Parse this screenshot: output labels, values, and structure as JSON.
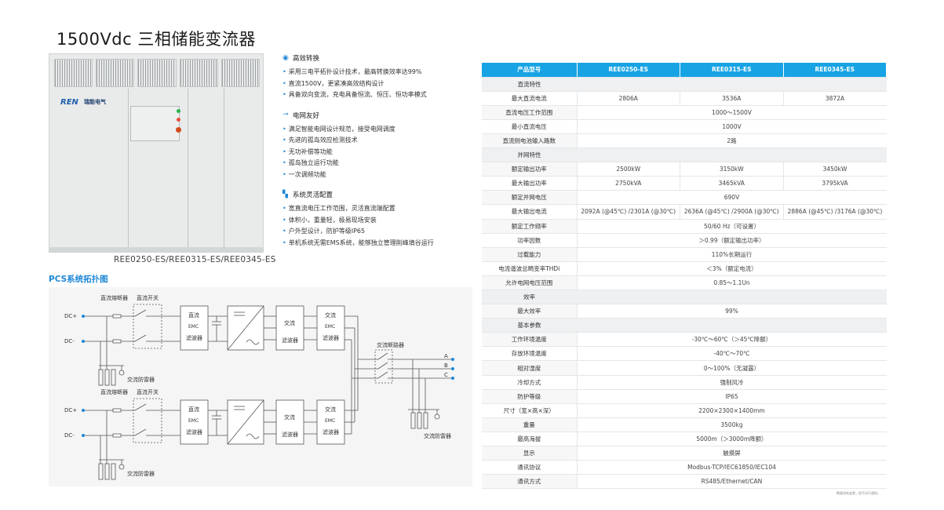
{
  "title": "1500Vdc 三相储能变流器",
  "cabinet": {
    "brand": "REN",
    "brand_cn": "瑞能电气",
    "brand_en": "Reneera Electric"
  },
  "model_caption": "REE0250-ES/REE0315-ES/REE0345-ES",
  "features": [
    {
      "heading": "高效转换",
      "icon": "efficiency-icon",
      "items": [
        "采用三电平拓扑设计技术，最高转换效率达99%",
        "直流1500V，更紧凑高效结构设计",
        "具备双向变流，充电具备恒流、恒压、恒功率模式"
      ]
    },
    {
      "heading": "电网友好",
      "icon": "grid-icon",
      "items": [
        "满足智能电网设计规范，接受电网调度",
        "先进的孤岛效应检测技术",
        "无功补偿等功能",
        "孤岛独立运行功能",
        "一次调频功能"
      ]
    },
    {
      "heading": "系统灵活配置",
      "icon": "config-icon",
      "items": [
        "宽直流电压工作范围，灵活直流端配置",
        "体积小，重量轻，极易现场安装",
        "户外型设计，防护等级IP65",
        "单机系统无需EMS系统，能够独立管理削峰填谷运行"
      ]
    }
  ],
  "topology": {
    "title": "PCS系统拓扑图",
    "dc_fuse": "直流熔断器",
    "dc_switch": "直流开关",
    "dc_plus": "DC+",
    "dc_minus": "DC-",
    "dc_emc": [
      "直流",
      "EMC",
      "滤波器"
    ],
    "ac_filter": [
      "交流",
      "滤波器"
    ],
    "ac_emc": [
      "交流",
      "EMC",
      "滤波器"
    ],
    "ac_breaker": "交流断路器",
    "surge": "交流防雷器",
    "phases": [
      "A",
      "B",
      "C"
    ]
  },
  "spec": {
    "header": [
      "产品型号",
      "REE0250-ES",
      "REE0315-ES",
      "REE0345-ES"
    ],
    "rows": [
      {
        "type": "section",
        "label": "直流特性"
      },
      {
        "label": "最大直流电流",
        "values": [
          "2806A",
          "3536A",
          "3872A"
        ]
      },
      {
        "label": "直流电压工作范围",
        "span": "1000～1500V"
      },
      {
        "label": "最小直流电压",
        "span": "1000V"
      },
      {
        "label": "直流侧电池输入路数",
        "span": "2路"
      },
      {
        "type": "section",
        "label": "并网特性"
      },
      {
        "label": "额定输出功率",
        "values": [
          "2500kW",
          "3150kW",
          "3450kW"
        ]
      },
      {
        "label": "最大输出功率",
        "values": [
          "2750kVA",
          "3465kVA",
          "3795kVA"
        ]
      },
      {
        "label": "额定并网电压",
        "span": "690V"
      },
      {
        "label": "最大输出电流",
        "values": [
          "2092A (@45℃) /2301A (@30℃)",
          "2636A (@45℃) /2900A (@30℃)",
          "2886A (@45℃) /3176A (@30℃)"
        ]
      },
      {
        "label": "额定工作频率",
        "span": "50/60 Hz（可设置）"
      },
      {
        "label": "功率因数",
        "span": "＞0.99（额定输出功率）"
      },
      {
        "label": "过载能力",
        "span": "110%长期运行"
      },
      {
        "label": "电流谐波总畸变率THDi",
        "span": "＜3%（额定电流）"
      },
      {
        "label": "允许电网电压范围",
        "span": "0.85～1.1Un"
      },
      {
        "type": "section",
        "label": "效率"
      },
      {
        "label": "最大效率",
        "span": "99%"
      },
      {
        "type": "section",
        "label": "基本参数"
      },
      {
        "label": "工作环境温度",
        "span": "-30℃～60℃（＞45℃降额）"
      },
      {
        "label": "存放环境温度",
        "span": "-40℃～70℃"
      },
      {
        "label": "相对湿度",
        "span": "0～100%（无凝露）"
      },
      {
        "label": "冷却方式",
        "span": "强制风冷"
      },
      {
        "label": "防护等级",
        "span": "IP65"
      },
      {
        "label": "尺寸（宽×高×深）",
        "span": "2200×2300×1400mm"
      },
      {
        "label": "重量",
        "span": "3500kg"
      },
      {
        "label": "最高海拔",
        "span": "5000m（＞3000m降额）"
      },
      {
        "label": "显示",
        "span": "触摸屏"
      },
      {
        "label": "通讯协议",
        "span": "Modbus-TCP/IEC61850/IEC104"
      },
      {
        "label": "通讯方式",
        "span": "RS485/Ethernet/CAN"
      }
    ]
  },
  "footnote": "数据如有变更，恕不另行通知。"
}
